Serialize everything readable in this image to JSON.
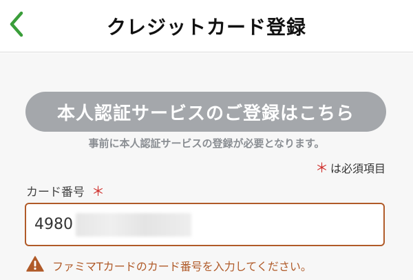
{
  "header": {
    "title": "クレジットカード登録",
    "back_icon": "chevron-left-icon",
    "accent_color": "#3a9e3a"
  },
  "auth": {
    "button_label": "本人認証サービスのご登録はこちら",
    "note": "事前に本人認証サービスの登録が必要となります。"
  },
  "form": {
    "required_mark": "＊",
    "required_note": "は必須項目",
    "card_number_label": "カード番号",
    "card_number_value": "4980",
    "error_message": "ファミマTカードのカード番号を入力してください。",
    "error_icon": "warning-icon",
    "error_color": "#b05a28"
  }
}
